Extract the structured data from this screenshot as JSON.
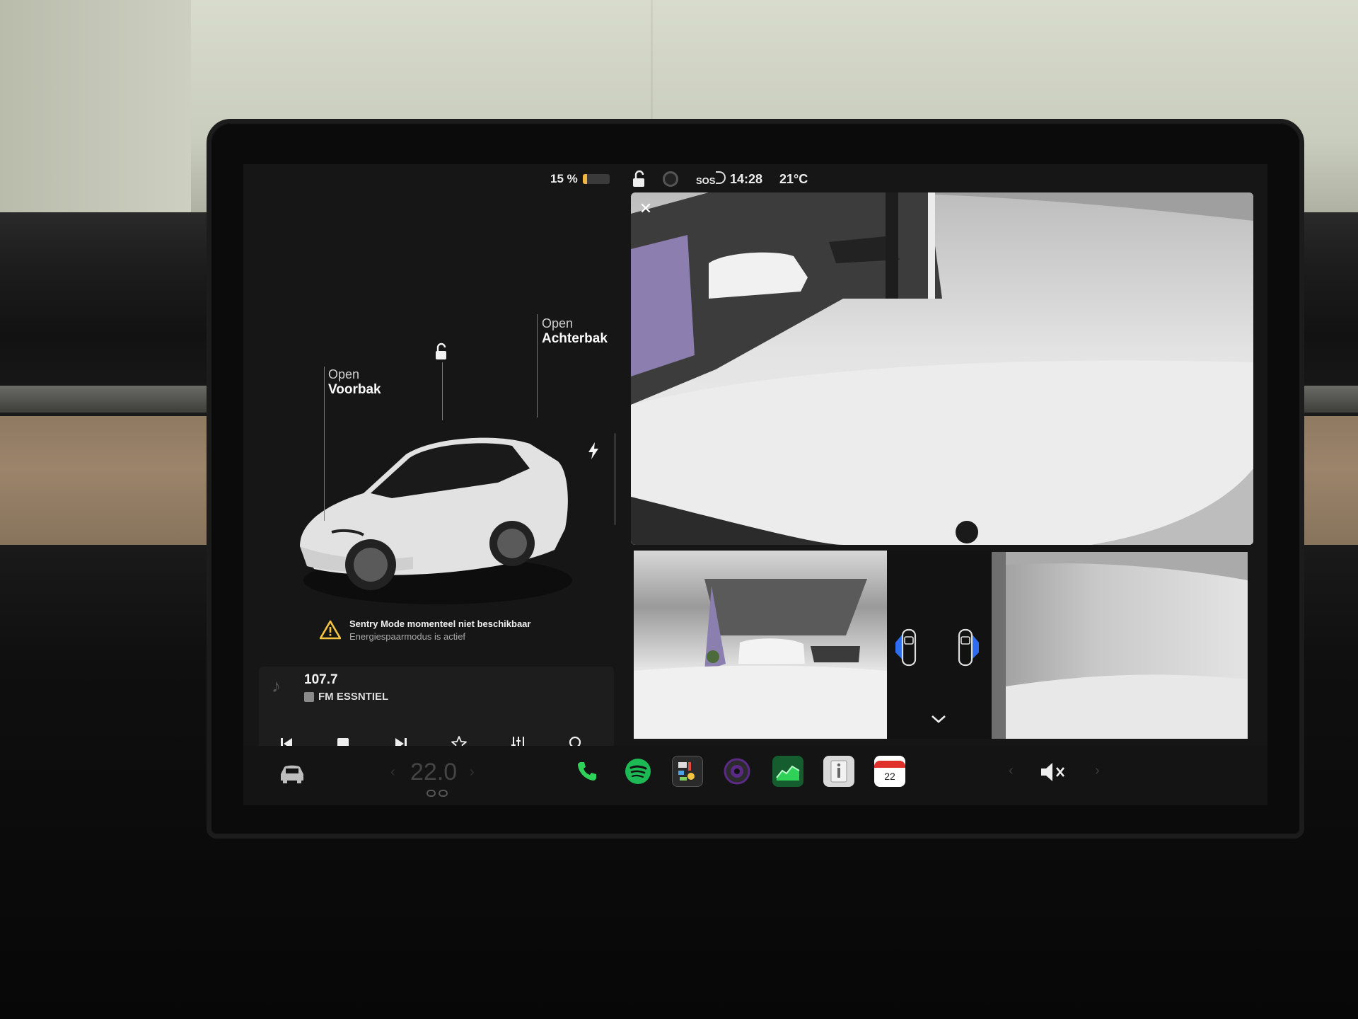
{
  "status_bar": {
    "battery_percent_label": "15 %",
    "battery_level": 0.15,
    "battery_color": "#f0b640",
    "lock_state_icon": "lock-open-icon",
    "sentry_icon": "sentry-eye-icon",
    "sos_label": "SOS",
    "time": "14:28",
    "outside_temp": "21°C"
  },
  "vehicle": {
    "frunk": {
      "action": "Open",
      "target": "Voorbak"
    },
    "trunk": {
      "action": "Open",
      "target": "Achterbak"
    },
    "lock_icon": "unlock-icon",
    "charge_icon": "lightning-icon",
    "car_render_color": "#e8e8e8"
  },
  "sentry_notice": {
    "title": "Sentry Mode momenteel niet beschikbaar",
    "subtitle": "Energiespaarmodus is actief",
    "icon": "warning-icon",
    "icon_color": "#f5c542"
  },
  "media": {
    "frequency": "107.7",
    "station": "FM ESSNTIEL",
    "controls": [
      "previous-track",
      "stop",
      "next-track",
      "favorite",
      "equalizer",
      "search"
    ]
  },
  "cameras": {
    "close_icon": "✕",
    "views": [
      "rear-camera",
      "left-repeater-camera",
      "right-repeater-camera"
    ],
    "chevron": "chevron-down-icon"
  },
  "dock": {
    "climate_temp": "22.0",
    "apps": [
      {
        "name": "phone",
        "color": "#2fd158"
      },
      {
        "name": "spotify",
        "color": "#1db954"
      },
      {
        "name": "toybox",
        "color": "#3a3a3a"
      },
      {
        "name": "camera",
        "color": "#5b2a86"
      },
      {
        "name": "energy",
        "color": "#1e9e4a"
      },
      {
        "name": "manual",
        "color": "#d9d9d9"
      },
      {
        "name": "calendar",
        "color": "#ffffff"
      }
    ],
    "calendar_day": "22",
    "volume_icon": "volume-mute-icon"
  }
}
